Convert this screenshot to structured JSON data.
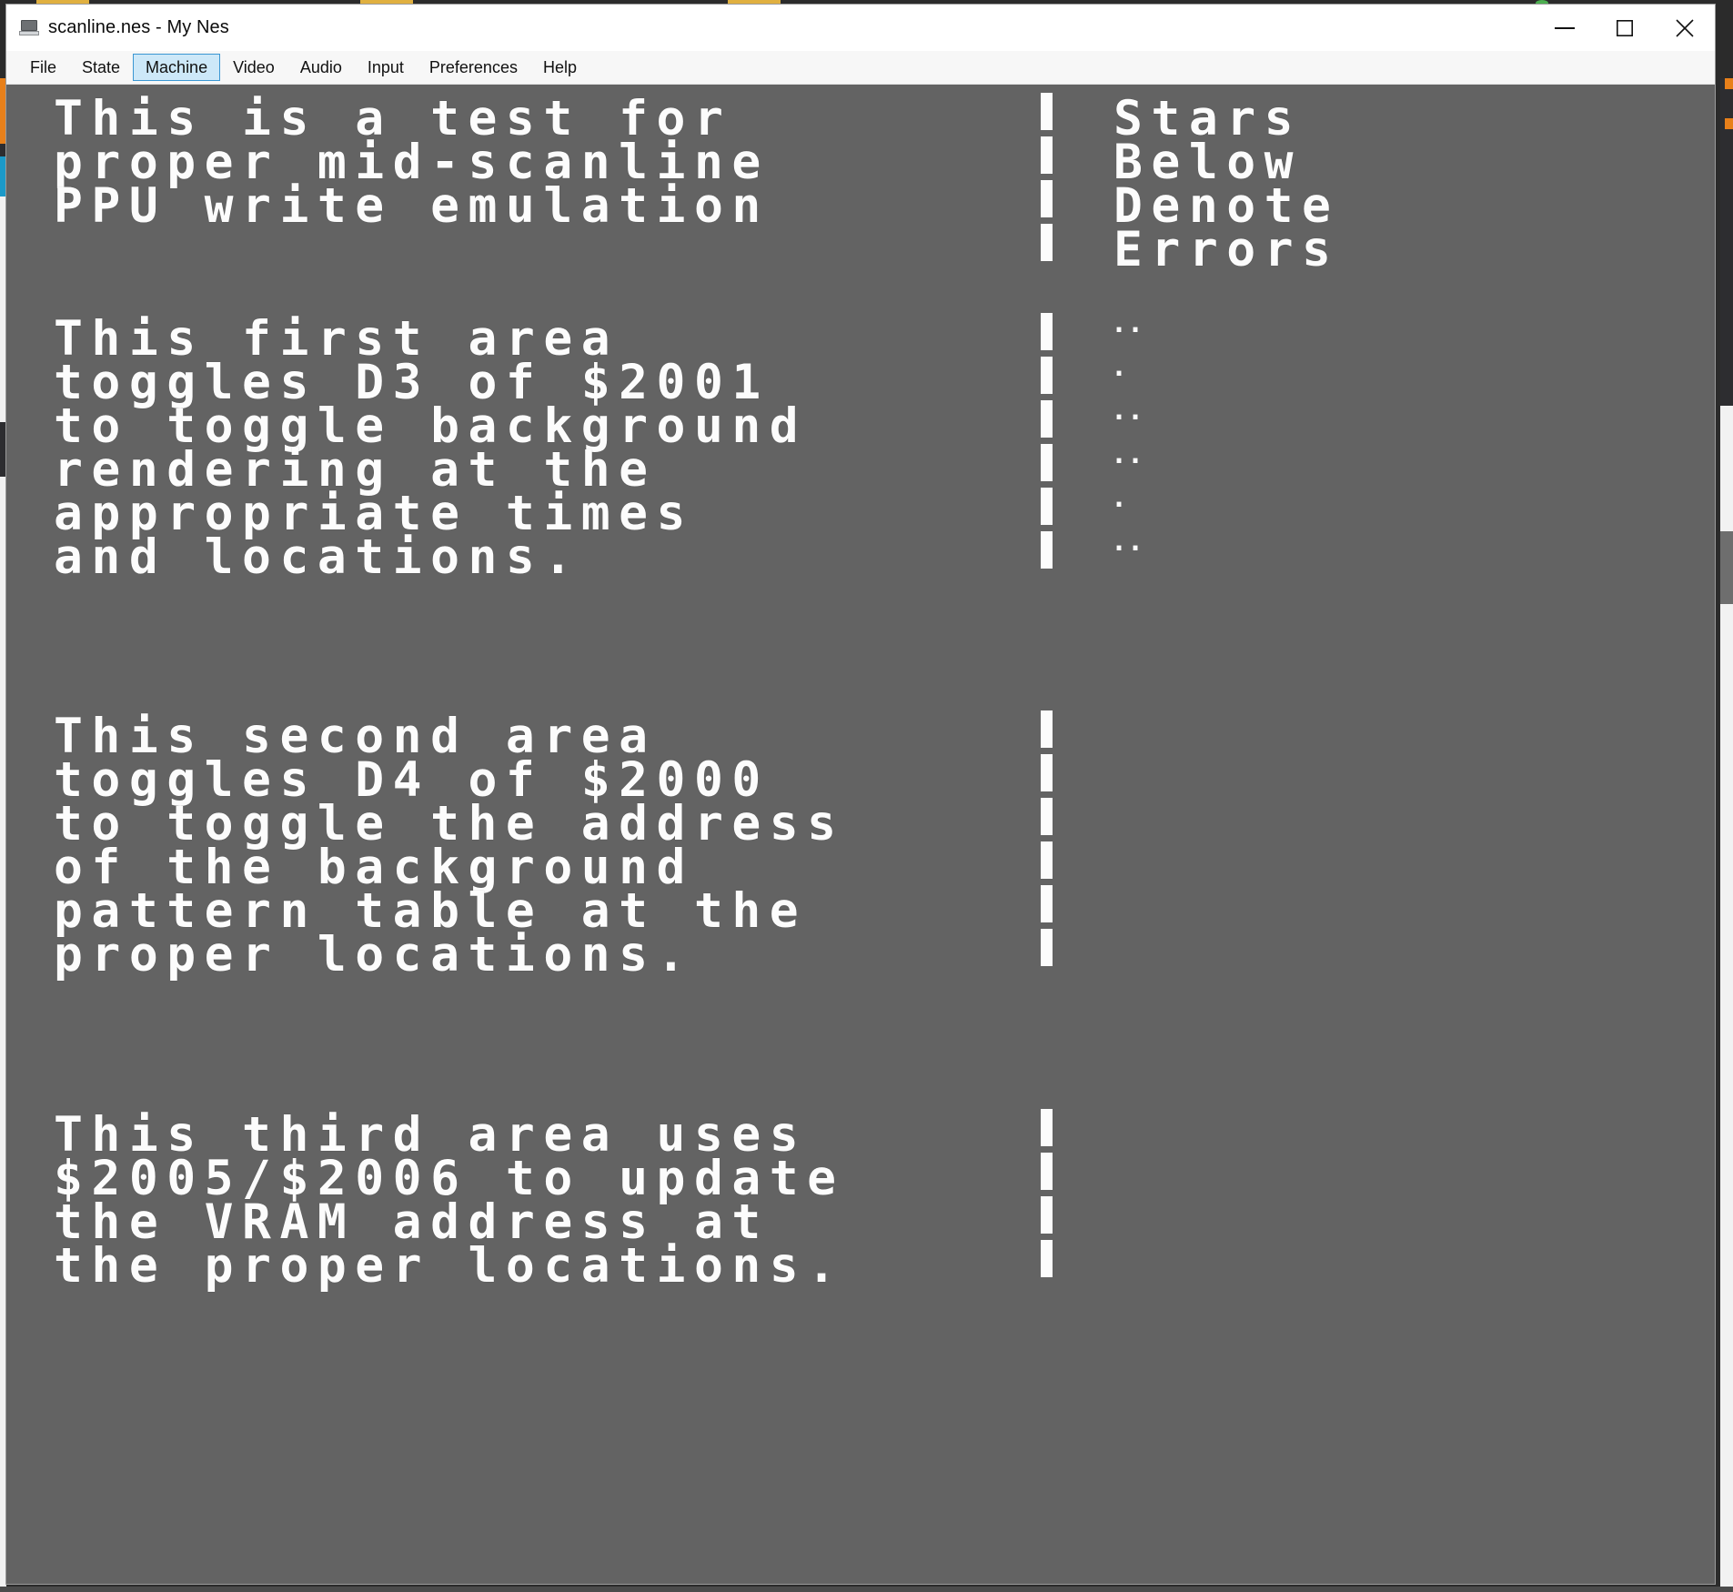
{
  "window": {
    "title": "scanline.nes - My Nes",
    "icon": "nes-cartridge-icon",
    "controls": {
      "minimize": "minimize-icon",
      "maximize": "maximize-icon",
      "close": "close-icon"
    }
  },
  "menubar": {
    "items": [
      {
        "label": "File",
        "active": false
      },
      {
        "label": "State",
        "active": false
      },
      {
        "label": "Machine",
        "active": true
      },
      {
        "label": "Video",
        "active": false
      },
      {
        "label": "Audio",
        "active": false
      },
      {
        "label": "Input",
        "active": false
      },
      {
        "label": "Preferences",
        "active": false
      },
      {
        "label": "Help",
        "active": false
      }
    ]
  },
  "screen": {
    "background_color": "#636363",
    "text_color": "#fcfcfc",
    "intro": {
      "lines": [
        "This is a test for",
        "proper mid-scanline",
        "PPU write emulation"
      ]
    },
    "legend": {
      "lines": [
        "Stars",
        "Below",
        "Denote",
        "Errors"
      ]
    },
    "block1": {
      "lines": [
        "This first area",
        "toggles D3 of $2001",
        "to toggle background",
        "rendering at the",
        "appropriate times",
        "and locations."
      ]
    },
    "block2": {
      "lines": [
        "This second area",
        "toggles D4 of $2000",
        "to toggle the address",
        "of the background",
        "pattern table at the",
        "proper locations."
      ]
    },
    "block3": {
      "lines": [
        "This third area uses",
        "$2005/$2006 to update",
        "the VRAM address at",
        "the proper locations."
      ]
    },
    "result_marks": [
      "··",
      "·",
      "··",
      "··",
      "·",
      "··"
    ]
  }
}
